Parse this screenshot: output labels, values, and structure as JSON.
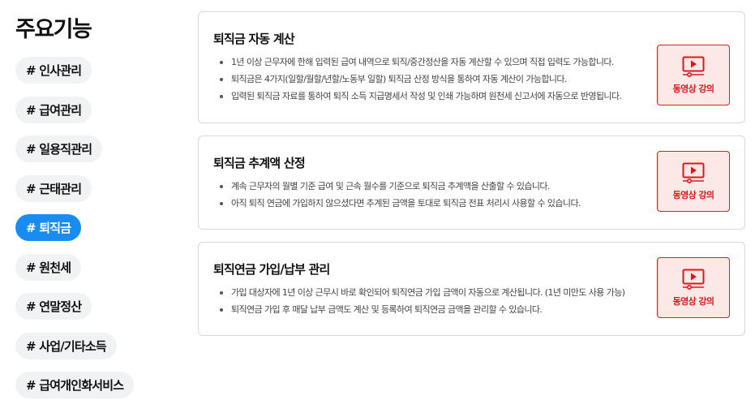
{
  "page": {
    "title": "주요기능"
  },
  "nav": {
    "items": [
      {
        "label": "# 인사관리"
      },
      {
        "label": "# 급여관리"
      },
      {
        "label": "# 일용직관리"
      },
      {
        "label": "# 근태관리"
      },
      {
        "label": "# 퇴직금"
      },
      {
        "label": "# 원천세"
      },
      {
        "label": "# 연말정산"
      },
      {
        "label": "# 사업/기타소득"
      },
      {
        "label": "# 급여개인화서비스"
      }
    ],
    "active_label": "# 퇴직금"
  },
  "colors": {
    "accent": "#1a8cf0",
    "video_red": "#e02020",
    "video_bg": "#fde8e8"
  },
  "cards": [
    {
      "title": "퇴직금 자동 계산",
      "bullets": [
        "1년 이상 근무자에 한해 입력된 급여 내역으로 퇴직/중간정산을 자동 계산할 수 있으며 직접 입력도 가능합니다.",
        "퇴직금은 4가지(일할/월할/년할/노동부 일할) 퇴직금 산정 방식을 통하여 자동 계산이 가능합니다.",
        "입력된 퇴직금 자료를 통하여 퇴직 소득 지급명세서 작성 및 인쇄 가능하며 원천세 신고서에 자동으로 반영됩니다."
      ],
      "video_label": "동영상 강의",
      "video_icon": "video-play-icon"
    },
    {
      "title": "퇴직금 추계액 산정",
      "bullets": [
        "계속 근무자의 월별 기준 급여 및 근속 월수를 기준으로 퇴직금 추계액을 산출할 수 있습니다.",
        "아직 퇴직 연금에 가입하지 않으셨다면 추계된 금액을 토대로 퇴직금 전표 처리시 사용할 수 있습니다."
      ],
      "video_label": "동영상 강의",
      "video_icon": "video-play-icon"
    },
    {
      "title": "퇴직연금 가입/납부 관리",
      "bullets": [
        "가입 대상자에 1년 이상 근무시 바로 확인되어 퇴직연금 가입 금액이 자동으로 계산됩니다. (1년 미만도 사용 가능)",
        "퇴직연금 가입 후 매달 납부 금액도 계산 및 등록하여 퇴직연금 금액을 관리할 수 있습니다."
      ],
      "video_label": "동영상 강의",
      "video_icon": "video-play-icon"
    }
  ]
}
